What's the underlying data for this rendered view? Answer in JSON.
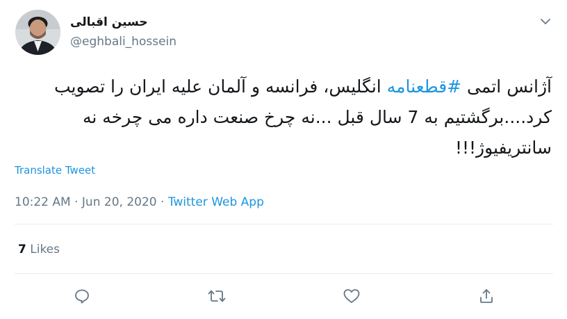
{
  "author": {
    "display_name": "حسین اقبالی",
    "handle": "@eghbali_hossein"
  },
  "tweet": {
    "text_before_hashtag": "آژانس اتمی ",
    "hashtag": "#قطعنامه",
    "text_after_hashtag": " انگلیس، فرانسه و آلمان علیه ایران را تصویب کرد....برگشتیم به 7 سال قبل ...نه چرخ صنعت داره می چرخه نه سانتریفیوژ!!!"
  },
  "translate_label": "Translate Tweet",
  "meta": {
    "time": "10:22 AM",
    "separator_1": " · ",
    "date": "Jun 20, 2020",
    "separator_2": " · ",
    "source": "Twitter Web App"
  },
  "stats": {
    "likes_count": "7",
    "likes_label": " Likes"
  },
  "icons": {
    "more": "chevron-down-icon",
    "reply": "reply-icon",
    "retweet": "retweet-icon",
    "like": "heart-icon",
    "share": "share-icon"
  },
  "colors": {
    "link": "#1b95e0",
    "secondary_text": "#657786",
    "primary_text": "#14171a",
    "divider": "#e6ecf0"
  }
}
